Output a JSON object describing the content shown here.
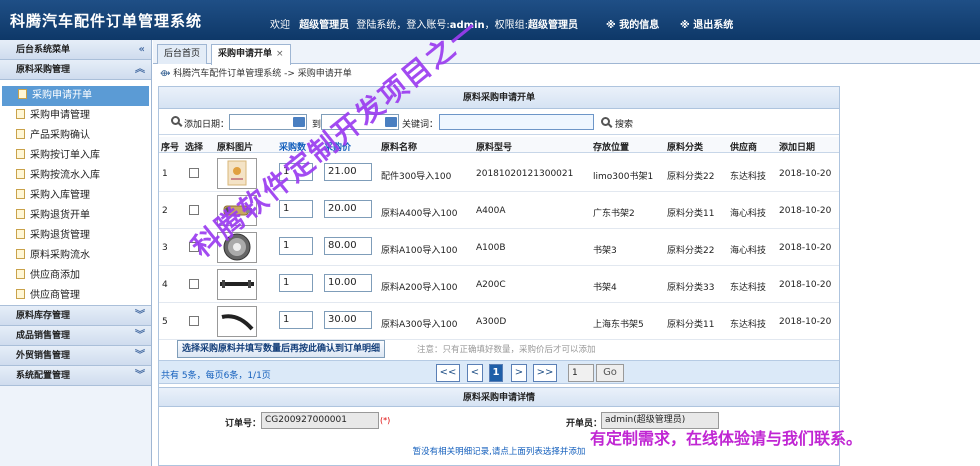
{
  "header": {
    "title": "科腾汽车配件订单管理系统",
    "welcome": "欢迎",
    "role_name": "超级管理员",
    "login_text": "登陆系统，登入账号:",
    "account": "admin",
    "perm_text": "，权限组:",
    "perm_group": "超级管理员",
    "my_info": "※ 我的信息",
    "logout": "※ 退出系统"
  },
  "sidebar": {
    "header": "后台系统菜单",
    "group1": "原料采购管理",
    "items": [
      {
        "label": "采购申请开单",
        "active": true
      },
      {
        "label": "采购申请管理"
      },
      {
        "label": "产品采购确认"
      },
      {
        "label": "采购按订单入库"
      },
      {
        "label": "采购按流水入库"
      },
      {
        "label": "采购入库管理"
      },
      {
        "label": "采购退货开单"
      },
      {
        "label": "采购退货管理"
      },
      {
        "label": "原料采购流水"
      },
      {
        "label": "供应商添加"
      },
      {
        "label": "供应商管理"
      }
    ],
    "groups": [
      "原料库存管理",
      "成品销售管理",
      "外贸销售管理",
      "系统配置管理"
    ]
  },
  "tabs": [
    {
      "label": "后台首页"
    },
    {
      "label": "采购申请开单",
      "close": "×"
    }
  ],
  "breadcrumb": "科腾汽车配件订单管理系统 -> 采购申请开单",
  "panel": {
    "title": "原料采购申请开单",
    "filter": {
      "date_label": "添加日期：",
      "to_label": "到",
      "keyword_label": "关键词：",
      "search_label": "搜索"
    },
    "columns": [
      "序号",
      "选择",
      "原料图片",
      "采购数",
      "采购价",
      "原料名称",
      "原料型号",
      "存放位置",
      "原料分类",
      "供应商",
      "添加日期"
    ],
    "rows": [
      {
        "no": "1",
        "qty": "1",
        "price": "21.00",
        "name": "配件300导入100",
        "model": "20181020121300021",
        "location": "limo300书架1",
        "category": "原料分类22",
        "supplier": "东达科技",
        "date": "2018-10-20"
      },
      {
        "no": "2",
        "qty": "1",
        "price": "20.00",
        "name": "原料A400导入100",
        "model": "A400A",
        "location": "广东书架2",
        "category": "原料分类11",
        "supplier": "海心科技",
        "date": "2018-10-20"
      },
      {
        "no": "3",
        "qty": "1",
        "price": "80.00",
        "name": "原料A100导入100",
        "model": "A100B",
        "location": "书架3",
        "category": "原料分类22",
        "supplier": "海心科技",
        "date": "2018-10-20"
      },
      {
        "no": "4",
        "qty": "1",
        "price": "10.00",
        "name": "原料A200导入100",
        "model": "A200C",
        "location": "书架4",
        "category": "原料分类33",
        "supplier": "东达科技",
        "date": "2018-10-20"
      },
      {
        "no": "5",
        "qty": "1",
        "price": "30.00",
        "name": "原料A300导入100",
        "model": "A300D",
        "location": "上海东书架5",
        "category": "原料分类11",
        "supplier": "东达科技",
        "date": "2018-10-20"
      }
    ],
    "confirm_button": "选择采购原料并填写数量后再按此确认到订单明细",
    "note": "注意：只有正确填好数量，采购价后才可以添加",
    "pager": {
      "info": "共有 5条，每页6条，1/1页",
      "first": "<<",
      "prev": "<",
      "current": "1",
      "next": ">",
      "last": ">>",
      "goto_value": "1",
      "go": "Go"
    }
  },
  "detail": {
    "title": "原料采购申请详情",
    "order_label": "订单号：",
    "order_no": "CG200927000001",
    "required_mark": "(*)",
    "opener_label": "开单员：",
    "opener": "admin(超级管理员)",
    "empty": "暂没有相关明细记录,请点上面列表选择并添加"
  },
  "overlay": {
    "watermark": "科腾软件定制开发项目之一",
    "ad": "有定制需求，在线体验请与我们联系。"
  },
  "colors": {
    "header_bg": "#0e3868",
    "active_menu": "#5b9bd5",
    "link_blue": "#1560bd",
    "watermark": "#9b3cf0",
    "ad": "#c026d3"
  }
}
